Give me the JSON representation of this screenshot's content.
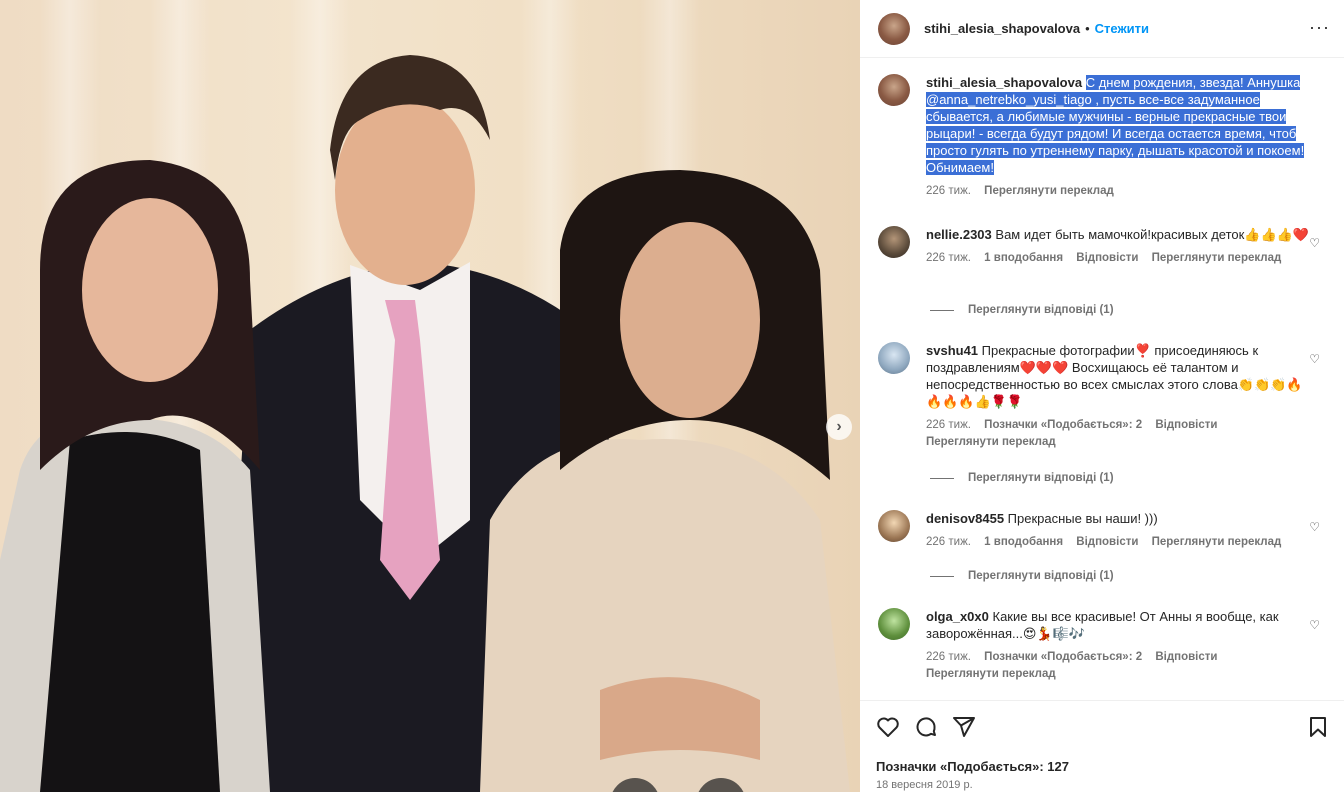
{
  "post": {
    "username": "stihi_alesia_shapovalova",
    "dot": "•",
    "follow_label": "Стежити",
    "more_label": "···"
  },
  "caption": {
    "username": "stihi_alesia_shapovalova",
    "text": "С днем рождения, звезда! Аннушка @anna_netrebko_yusi_tiago , пусть все-все задуманное сбывается, а любимые мужчины - верные прекрасные твои рыцари! - всегда будут рядом! И всегда остается время, чтоб просто гулять по утреннему парку, дышать красотой и покоем! Обнимаем!",
    "time": "226 тиж.",
    "translate": "Переглянути переклад"
  },
  "comments": [
    {
      "username": "nellie.2303",
      "text": "Вам идет быть мамочкой!красивых деток👍👍👍❤️",
      "time": "226 тиж.",
      "likes": "1 вподобання",
      "reply": "Відповісти",
      "translate": "Переглянути переклад",
      "view_replies": "Переглянути відповіді (1)"
    },
    {
      "username": "svshu41",
      "text": "Прекрасные фотографии❣️ присоединяюсь к поздравлениям❤️❤️❤️ Восхищаюсь её талантом и непосредственностью во всех смыслах этого слова👏👏👏🔥🔥🔥🔥👍🌹🌹",
      "time": "226 тиж.",
      "likes": "Позначки «Подобається»: 2",
      "reply": "Відповісти",
      "translate": "Переглянути переклад",
      "view_replies": "Переглянути відповіді (1)"
    },
    {
      "username": "denisov8455",
      "text": "Прекрасные вы наши! )))",
      "time": "226 тиж.",
      "likes": "1 вподобання",
      "reply": "Відповісти",
      "translate": "Переглянути переклад",
      "view_replies": "Переглянути відповіді (1)"
    },
    {
      "username": "olga_x0x0",
      "text": "Какие вы все красивые! От Анны я вообще, как заворожённая...😍💃🎼🎶",
      "time": "226 тиж.",
      "likes": "Позначки «Подобається»: 2",
      "reply": "Відповісти",
      "translate": "Переглянути переклад"
    }
  ],
  "footer": {
    "likes": "Позначки «Подобається»: 127",
    "date": "18 вересня 2019 р."
  },
  "icons": {
    "like": "heart-icon",
    "comment": "comment-icon",
    "share": "send-icon",
    "save": "bookmark-icon",
    "next": "chevron-right-icon"
  },
  "colors": {
    "accent": "#0095f6",
    "selection": "#3b6fd6",
    "muted": "#737373"
  }
}
